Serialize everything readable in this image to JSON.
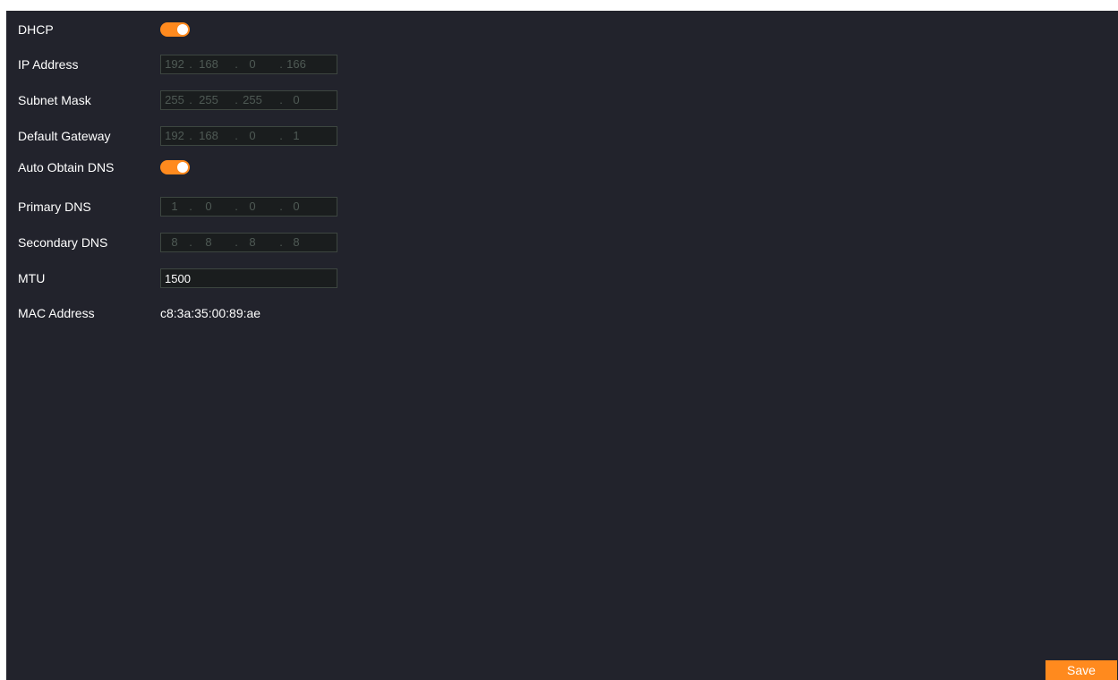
{
  "colors": {
    "panel_bg": "#22232c",
    "accent": "#ff8a1e",
    "input_border": "#3d4640",
    "disabled_text": "#4f5a55"
  },
  "form": {
    "dhcp": {
      "label": "DHCP",
      "enabled": true
    },
    "ip_address": {
      "label": "IP Address",
      "octets": [
        "192",
        "168",
        "0",
        "166"
      ],
      "disabled": true
    },
    "subnet_mask": {
      "label": "Subnet Mask",
      "octets": [
        "255",
        "255",
        "255",
        "0"
      ],
      "disabled": true
    },
    "default_gateway": {
      "label": "Default Gateway",
      "octets": [
        "192",
        "168",
        "0",
        "1"
      ],
      "disabled": true
    },
    "auto_dns": {
      "label": "Auto Obtain DNS",
      "enabled": true
    },
    "primary_dns": {
      "label": "Primary DNS",
      "octets": [
        "1",
        "0",
        "0",
        "0"
      ],
      "disabled": true
    },
    "secondary_dns": {
      "label": "Secondary DNS",
      "octets": [
        "8",
        "8",
        "8",
        "8"
      ],
      "disabled": true
    },
    "mtu": {
      "label": "MTU",
      "value": "1500"
    },
    "mac_address": {
      "label": "MAC Address",
      "value": "c8:3a:35:00:89:ae"
    }
  },
  "separator": ".",
  "footer": {
    "save_label": "Save"
  }
}
